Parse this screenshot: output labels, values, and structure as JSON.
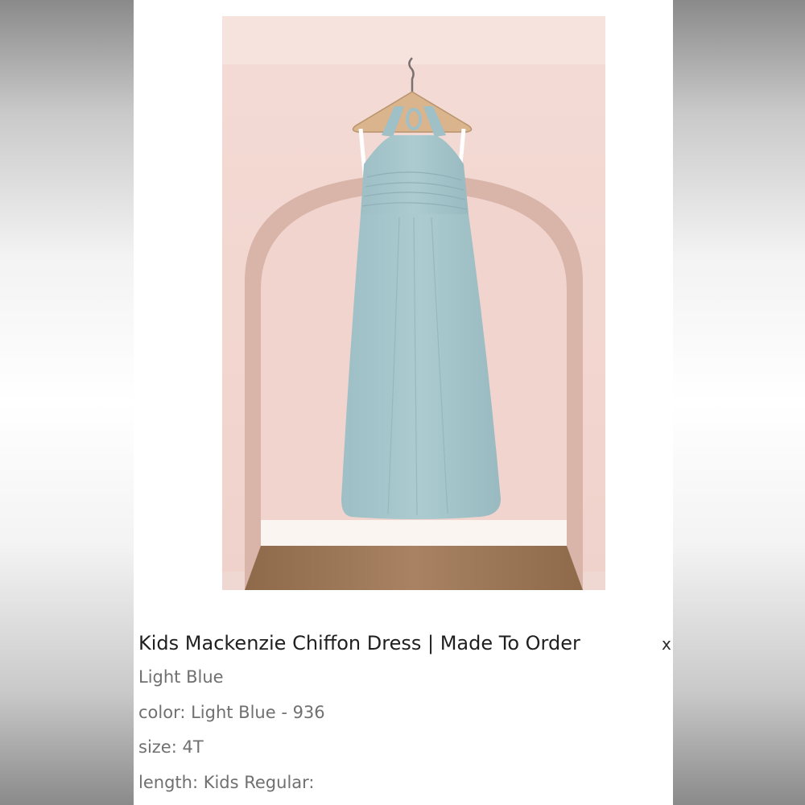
{
  "product": {
    "image_alt": "Light blue halter chiffon dress on hanger",
    "title": "Kids Mackenzie Chiffon Dress | Made To Order",
    "remove_label": "x",
    "variant": "Light Blue",
    "color_line": "color: Light Blue - 936",
    "size_line": "size: 4T",
    "length_line": "length: Kids Regular:"
  },
  "colors": {
    "wall": "#f2d6d0",
    "arch_shadow": "#caa79c",
    "dress": "#a6c7cc",
    "floor": "#a07a58",
    "baseboard": "#faf4f1"
  }
}
